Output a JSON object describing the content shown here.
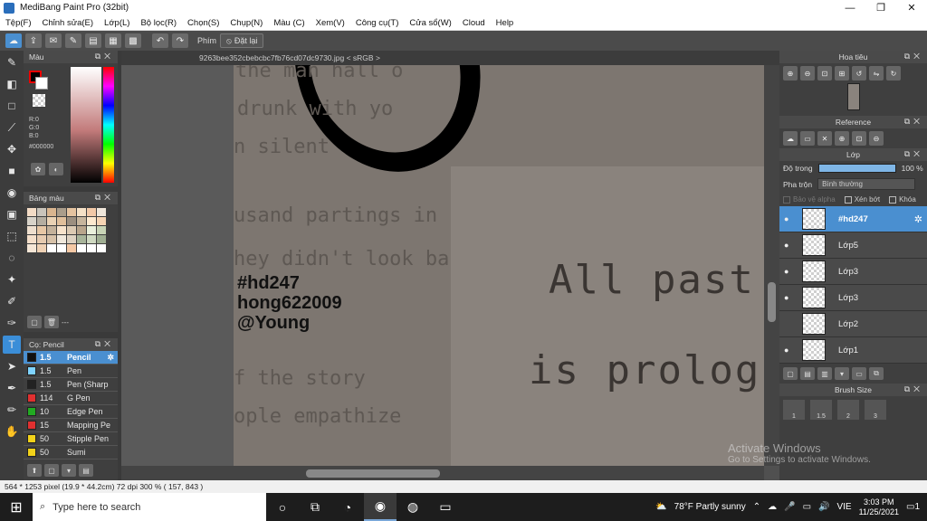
{
  "window": {
    "title": "MediBang Paint Pro (32bit)",
    "minimize": "—",
    "maximize": "❐",
    "close": "✕"
  },
  "menu": [
    "Tệp(F)",
    "Chỉnh sửa(E)",
    "Lớp(L)",
    "Bộ lọc(R)",
    "Chọn(S)",
    "Chụp(N)",
    "Màu (C)",
    "Xem(V)",
    "Công cụ(T)",
    "Cửa sổ(W)",
    "Cloud",
    "Help"
  ],
  "toolbar": {
    "key_label": "Phím",
    "reset_label": "Đặt lại"
  },
  "color_panel": {
    "title": "Màu",
    "r": "R:0",
    "g": "G:0",
    "b": "B:0",
    "hex": "#000000"
  },
  "palette_panel": {
    "title": "Bảng màu",
    "footer_text": "---",
    "swatches": [
      "#f3dcc6",
      "#c9c4bb",
      "#d9b58f",
      "#aa9d8b",
      "#e5c3a0",
      "#f5e1c7",
      "#f2c9a8",
      "#efe6da",
      "#d8d3c9",
      "#b5aea1",
      "#ead2b4",
      "#e0bf9b",
      "#9c8f80",
      "#c7b59d",
      "#fde9cf",
      "#f6d4b3",
      "#eedfce",
      "#e7c7a5",
      "#c4b29b",
      "#f7e3cc",
      "#dccab3",
      "#b9a58c",
      "#eaf0dc",
      "#c8d4b6",
      "#f4dfca",
      "#e6cbb0",
      "#d7c2a9",
      "#f0e8dc",
      "#ded2c2",
      "#a8b49a",
      "#cfd9c1",
      "#9fae92",
      "#f5e6d6",
      "#efd2b5",
      "#ffffff",
      "#ffffff",
      "#f5c9a5",
      "#ffffff",
      "#ffffff",
      "#ffffff"
    ]
  },
  "brush_panel": {
    "title": "Cọ: Pencil",
    "items": [
      {
        "size": "1.5",
        "name": "Pencil",
        "color": "#111111"
      },
      {
        "size": "1.5",
        "name": "Pen",
        "color": "#7fd3ff"
      },
      {
        "size": "1.5",
        "name": "Pen (Sharp",
        "color": "#222222"
      },
      {
        "size": "114",
        "name": "G Pen",
        "color": "#e03030"
      },
      {
        "size": "10",
        "name": "Edge Pen",
        "color": "#22aa22"
      },
      {
        "size": "15",
        "name": "Mapping Pe",
        "color": "#e03030"
      },
      {
        "size": "50",
        "name": "Stipple Pen",
        "color": "#f2d21a"
      },
      {
        "size": "50",
        "name": "Sumi",
        "color": "#f2d21a"
      }
    ]
  },
  "document": {
    "tab_label": "9263bee352cbebcbc7fb76cd07dc9730.jpg < sRGB >",
    "bg_text": [
      "the man hall o",
      "drunk with yo",
      "n silent",
      "usand partings in",
      "hey didn't look ba",
      "f the story",
      "ople empathize"
    ],
    "big_text": [
      "All past",
      "is prologu"
    ],
    "signature": [
      "#hd247",
      "hong622009",
      "@Young"
    ]
  },
  "right_panels": {
    "nav_title": "Hoa tiêu",
    "ref_title": "Reference",
    "layer_title": "Lớp",
    "opacity_label": "Độ trong",
    "opacity_value": "100 %",
    "blend_label": "Pha trộn",
    "blend_value": "Bình thường",
    "protect_alpha": "Bảo vệ alpha",
    "clipping": "Xén bớt",
    "lock": "Khóa",
    "layers": [
      {
        "name": "#hd247",
        "selected": true,
        "visible": true
      },
      {
        "name": "Lớp5",
        "selected": false,
        "visible": true
      },
      {
        "name": "Lớp3",
        "selected": false,
        "visible": true
      },
      {
        "name": "Lớp3",
        "selected": false,
        "visible": true
      },
      {
        "name": "Lớp2",
        "selected": false,
        "visible": false
      },
      {
        "name": "Lớp1",
        "selected": false,
        "visible": true
      }
    ],
    "brush_size_title": "Brush Size",
    "brush_sizes": [
      "1",
      "1.5",
      "2",
      "3"
    ]
  },
  "status": {
    "text": "564 * 1253 pixel   (19.9 * 44.2cm)   72 dpi   300 %   ( 157, 843 )"
  },
  "watermark": {
    "line1": "Activate Windows",
    "line2": "Go to Settings to activate Windows."
  },
  "taskbar": {
    "search_placeholder": "Type here to search",
    "weather": "78°F  Partly sunny",
    "lang": "VIE",
    "time": "3:03 PM",
    "date": "11/25/2021",
    "notif_count": "1"
  }
}
